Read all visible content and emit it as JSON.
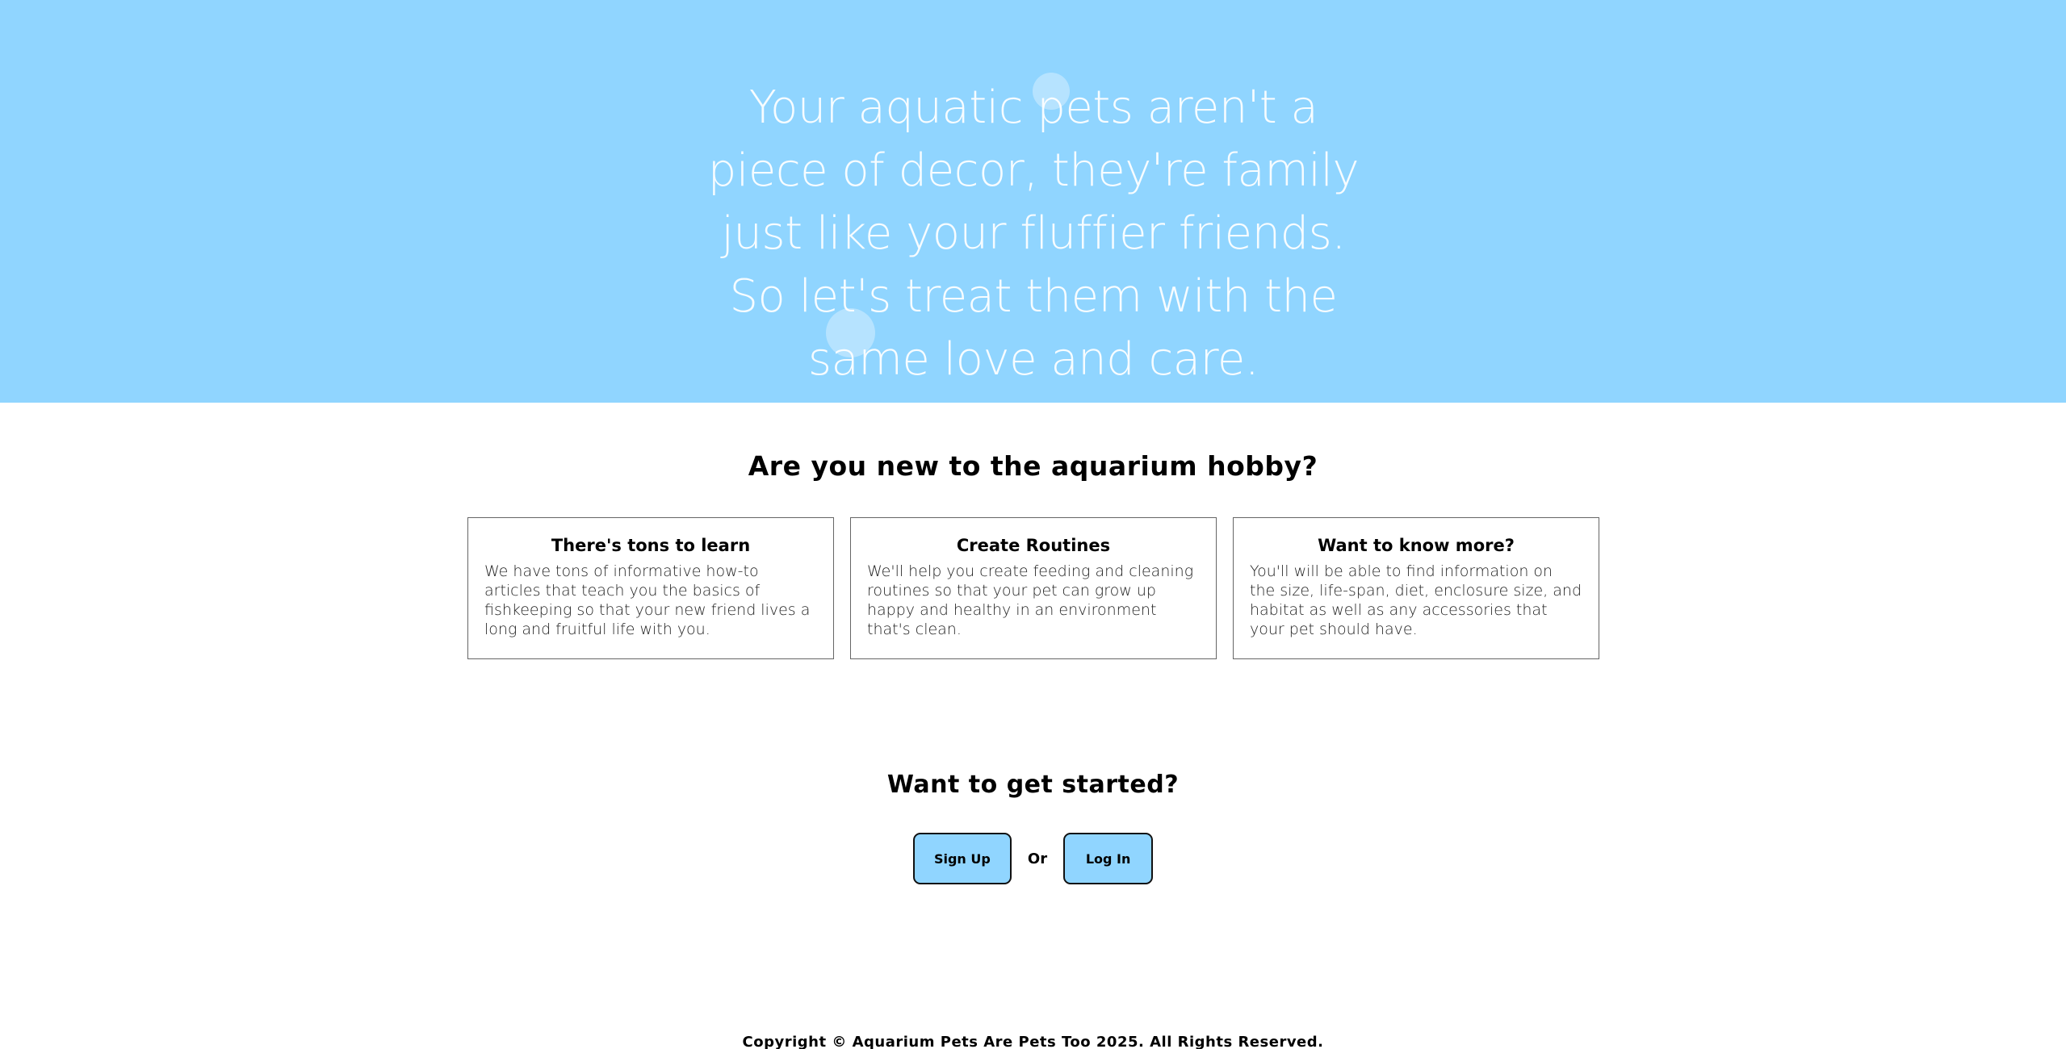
{
  "hero": {
    "quote": "Your aquatic pets aren't a piece of decor, they're family just like your fluffier friends. So let's treat them with the same love and care."
  },
  "intro": {
    "title": "Are you new to the aquarium hobby?",
    "cards": [
      {
        "title": "There's tons to learn",
        "body": "We have tons of informative how-to articles that teach you the basics of fishkeeping so that your new friend lives a long and fruitful life with you."
      },
      {
        "title": "Create Routines",
        "body": "We'll help you create feeding and cleaning routines so that your pet can grow up happy and healthy in an environment that's clean."
      },
      {
        "title": "Want to know more?",
        "body": "You'll will be able to find information on the size, life-span, diet, enclosure size, and habitat as well as any accessories that your pet should have."
      }
    ]
  },
  "cta": {
    "title": "Want to get started?",
    "signup_label": "Sign Up",
    "or_label": "Or",
    "login_label": "Log In"
  },
  "footer": {
    "copyright": "Copyright © Aquarium Pets Are Pets Too 2025. All Rights Reserved."
  },
  "colors": {
    "hero_background": "#90d5ff",
    "button_background": "#90d5ff"
  }
}
